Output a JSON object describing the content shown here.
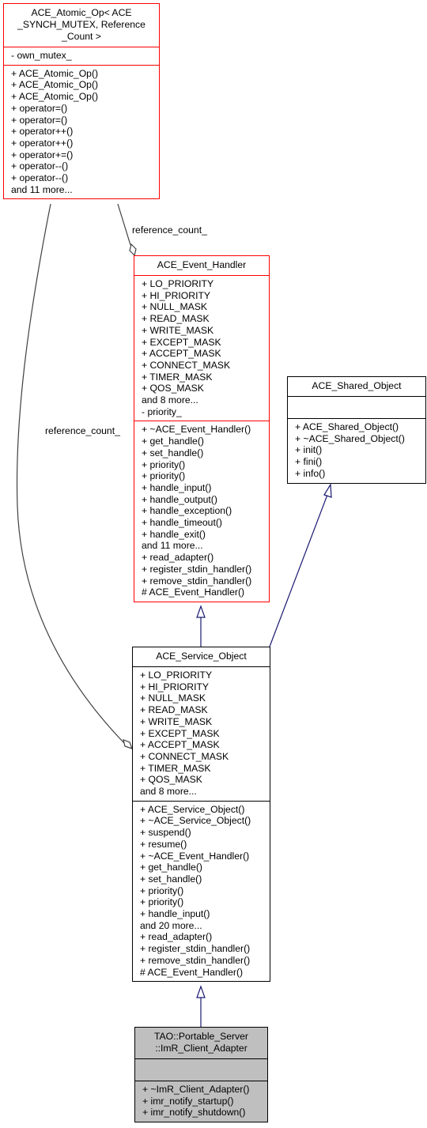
{
  "diagram": {
    "type": "class-inheritance-collaboration",
    "colors": {
      "highlight_border": "#ff0000",
      "normal_border": "#000000",
      "focus_fill": "#bfbfbf",
      "inheritance_edge": "#191970",
      "collaboration_edge": "#404040"
    },
    "classes": {
      "atomic_op": {
        "title_lines": [
          "ACE_Atomic_Op< ACE",
          "_SYNCH_MUTEX, Reference",
          "_Count >"
        ],
        "attributes": [
          "- own_mutex_"
        ],
        "methods": [
          "+ ACE_Atomic_Op()",
          "+ ACE_Atomic_Op()",
          "+ ACE_Atomic_Op()",
          "+ operator=()",
          "+ operator=()",
          "+ operator++()",
          "+ operator++()",
          "+ operator+=()",
          "+ operator--()",
          "+ operator--()",
          "and 11 more..."
        ]
      },
      "event_handler": {
        "title_lines": [
          "ACE_Event_Handler"
        ],
        "attributes": [
          "+ LO_PRIORITY",
          "+ HI_PRIORITY",
          "+ NULL_MASK",
          "+ READ_MASK",
          "+ WRITE_MASK",
          "+ EXCEPT_MASK",
          "+ ACCEPT_MASK",
          "+ CONNECT_MASK",
          "+ TIMER_MASK",
          "+ QOS_MASK",
          "and 8 more...",
          "- priority_"
        ],
        "methods": [
          "+ ~ACE_Event_Handler()",
          "+ get_handle()",
          "+ set_handle()",
          "+ priority()",
          "+ priority()",
          "+ handle_input()",
          "+ handle_output()",
          "+ handle_exception()",
          "+ handle_timeout()",
          "+ handle_exit()",
          "and 11 more...",
          "+ read_adapter()",
          "+ register_stdin_handler()",
          "+ remove_stdin_handler()",
          "# ACE_Event_Handler()"
        ]
      },
      "shared_object": {
        "title_lines": [
          "ACE_Shared_Object"
        ],
        "attributes": [],
        "methods": [
          "+ ACE_Shared_Object()",
          "+ ~ACE_Shared_Object()",
          "+ init()",
          "+ fini()",
          "+ info()"
        ]
      },
      "service_object": {
        "title_lines": [
          "ACE_Service_Object"
        ],
        "attributes": [
          "+ LO_PRIORITY",
          "+ HI_PRIORITY",
          "+ NULL_MASK",
          "+ READ_MASK",
          "+ WRITE_MASK",
          "+ EXCEPT_MASK",
          "+ ACCEPT_MASK",
          "+ CONNECT_MASK",
          "+ TIMER_MASK",
          "+ QOS_MASK",
          "and 8 more..."
        ],
        "methods": [
          "+ ACE_Service_Object()",
          "+ ~ACE_Service_Object()",
          "+ suspend()",
          "+ resume()",
          "+ ~ACE_Event_Handler()",
          "+ get_handle()",
          "+ set_handle()",
          "+ priority()",
          "+ priority()",
          "+ handle_input()",
          "and 20 more...",
          "+ read_adapter()",
          "+ register_stdin_handler()",
          "+ remove_stdin_handler()",
          "# ACE_Event_Handler()"
        ]
      },
      "imr_client_adapter": {
        "title_lines": [
          "TAO::Portable_Server",
          "::ImR_Client_Adapter"
        ],
        "attributes": [],
        "methods": [
          "+ ~ImR_Client_Adapter()",
          "+ imr_notify_startup()",
          "+ imr_notify_shutdown()"
        ]
      }
    },
    "edge_labels": {
      "atomic_to_event_handler": "reference_count_",
      "atomic_to_service_object": "reference_count_"
    }
  }
}
